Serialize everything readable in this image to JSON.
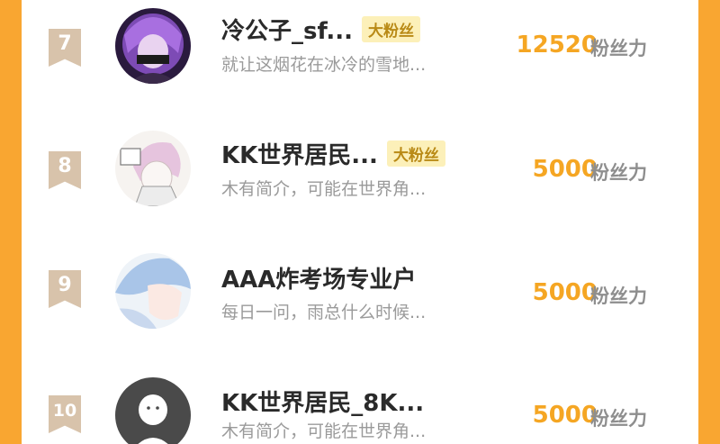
{
  "colors": {
    "frame": "#f9a631",
    "score": "#f5a623",
    "rank_ribbon": "#d8c3ab",
    "badge_bg": "#fcf0b9",
    "badge_text": "#b98a16"
  },
  "ranking": [
    {
      "rank": "7",
      "name": "冷公子_sf...",
      "badge": "大粉丝",
      "desc": "就让这烟花在冰冷的雪地...",
      "score": "12520",
      "unit": "粉丝力",
      "avatar": "purple-hair-avatar"
    },
    {
      "rank": "8",
      "name": "KK世界居民...",
      "badge": "大粉丝",
      "desc": "木有简介，可能在世界角...",
      "score": "5000",
      "unit": "粉丝力",
      "avatar": "sketch-pink-hair-avatar"
    },
    {
      "rank": "9",
      "name": "AAA炸考场专业户",
      "badge": "",
      "desc": "每日一问，雨总什么时候...",
      "score": "5000",
      "unit": "粉丝力",
      "avatar": "blue-hair-avatar"
    },
    {
      "rank": "10",
      "name": "KK世界居民_8K...",
      "badge": "",
      "desc": "木有简介，可能在世界角...",
      "score": "5000",
      "unit": "粉丝力",
      "avatar": "default-avatar"
    }
  ]
}
